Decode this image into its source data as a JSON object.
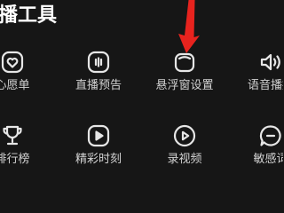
{
  "section": {
    "title": "播工具"
  },
  "tools_row1": [
    {
      "label": "心愿单",
      "icon": "heart-badge-icon"
    },
    {
      "label": "直播预告",
      "icon": "broadcast-box-icon"
    },
    {
      "label": "悬浮窗设置",
      "icon": "floating-window-icon"
    },
    {
      "label": "语音播报",
      "icon": "speaker-icon"
    }
  ],
  "tools_row2": [
    {
      "label": "排行榜",
      "icon": "trophy-icon"
    },
    {
      "label": "精彩时刻",
      "icon": "highlight-play-icon"
    },
    {
      "label": "录视频",
      "icon": "record-video-icon"
    },
    {
      "label": "敏感词",
      "icon": "chat-bubble-icon"
    }
  ],
  "colors": {
    "background": "#161616",
    "title": "#ffffff",
    "label": "#d2d2d2",
    "icon": "#e6e6e6",
    "annotation_arrow": "#e8231e"
  }
}
